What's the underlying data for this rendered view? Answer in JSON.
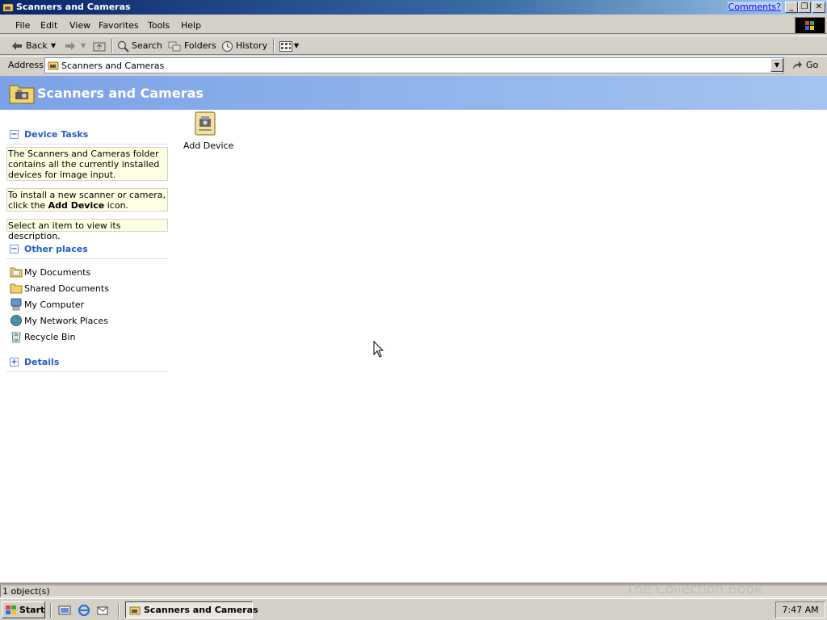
{
  "window": {
    "title": "Scanners and Cameras",
    "comments_link": "Comments?"
  },
  "menu": [
    "File",
    "Edit",
    "View",
    "Favorites",
    "Tools",
    "Help"
  ],
  "toolbar": {
    "back": "Back",
    "search": "Search",
    "folders": "Folders",
    "history": "History"
  },
  "address": {
    "label": "Address",
    "value": "Scanners and Cameras",
    "go": "Go"
  },
  "header": {
    "title": "Scanners and Cameras"
  },
  "left_pane": {
    "device_tasks": {
      "title": "Device Tasks",
      "note1": "The Scanners and Cameras folder contains all the currently installed devices for image input.",
      "note2_pre": "To install a new scanner or camera, click the ",
      "note2_bold": "Add Device",
      "note2_post": " icon.",
      "note3": "Select an item to view its description."
    },
    "other_places": {
      "title": "Other places",
      "items": [
        "My Documents",
        "Shared Documents",
        "My Computer",
        "My Network Places",
        "Recycle Bin"
      ]
    },
    "details": {
      "title": "Details"
    }
  },
  "content": {
    "items": [
      {
        "label": "Add Device",
        "icon": "add-device-icon"
      }
    ]
  },
  "status": {
    "text": "1 object(s)"
  },
  "taskbar": {
    "start": "Start",
    "task": "Scanners and Cameras",
    "clock": "7:47 AM",
    "watermark": "The Collection Book"
  }
}
